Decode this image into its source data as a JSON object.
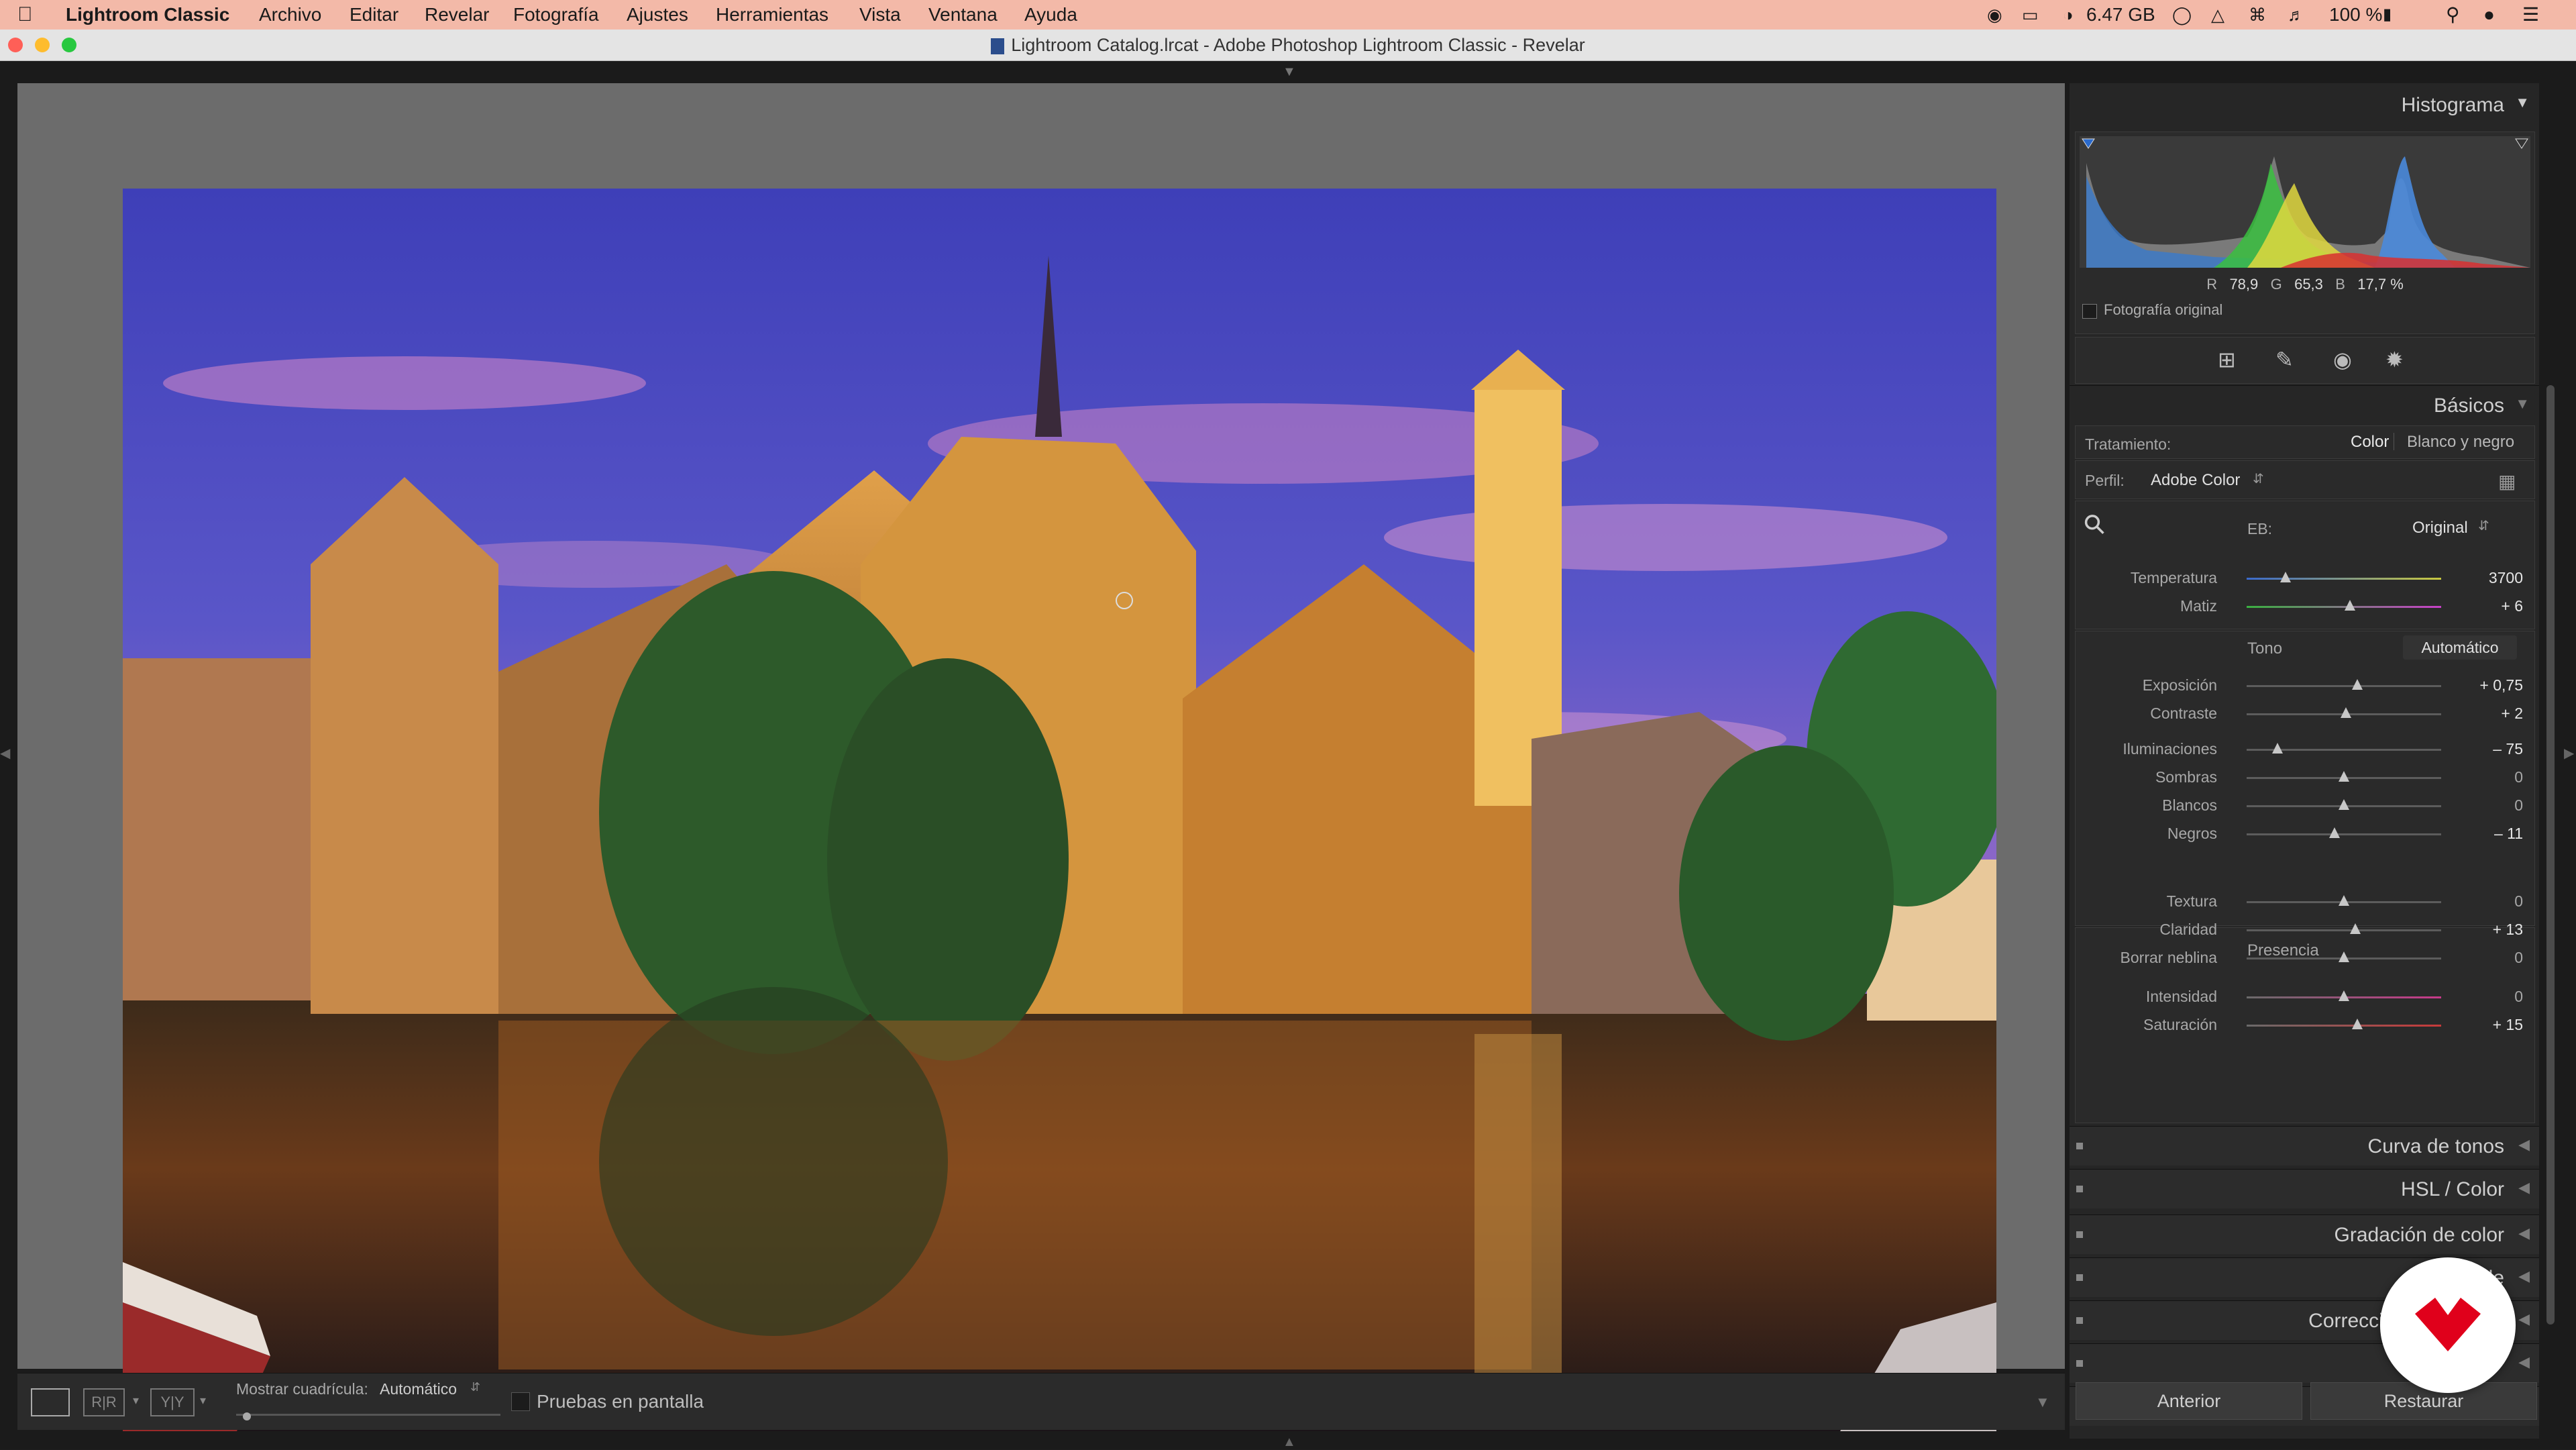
{
  "menubar": {
    "app_name": "Lightroom Classic",
    "items": [
      "Archivo",
      "Editar",
      "Revelar",
      "Fotografía",
      "Ajustes",
      "Herramientas",
      "Vista",
      "Ventana",
      "Ayuda"
    ],
    "status": {
      "memory": "6.47 GB",
      "battery": "100 %"
    }
  },
  "window": {
    "title": "Lightroom Catalog.lrcat - Adobe Photoshop Lightroom Classic - Revelar"
  },
  "histogram": {
    "title": "Histograma",
    "r_label": "R",
    "r_value": "78,9",
    "g_label": "G",
    "g_value": "65,3",
    "b_label": "B",
    "b_value": "17,7 %",
    "original_label": "Fotografía original"
  },
  "basics": {
    "title": "Básicos",
    "treatment_label": "Tratamiento:",
    "treatment_color": "Color",
    "treatment_bw": "Blanco y negro",
    "profile_label": "Perfil:",
    "profile_value": "Adobe Color",
    "wb_label": "EB:",
    "wb_value": "Original",
    "tone_label": "Tono",
    "auto_label": "Automático",
    "presence_label": "Presencia",
    "sliders": [
      {
        "name": "Temperatura",
        "value": "3700",
        "pos": 0.2
      },
      {
        "name": "Matiz",
        "value": "+ 6",
        "pos": 0.53
      },
      {
        "name": "Exposición",
        "value": "+ 0,75",
        "pos": 0.57
      },
      {
        "name": "Contraste",
        "value": "+ 2",
        "pos": 0.51
      },
      {
        "name": "Iluminaciones",
        "value": "– 75",
        "pos": 0.16
      },
      {
        "name": "Sombras",
        "value": "0",
        "pos": 0.5
      },
      {
        "name": "Blancos",
        "value": "0",
        "pos": 0.5
      },
      {
        "name": "Negros",
        "value": "– 11",
        "pos": 0.45
      },
      {
        "name": "Textura",
        "value": "0",
        "pos": 0.5
      },
      {
        "name": "Claridad",
        "value": "+ 13",
        "pos": 0.56
      },
      {
        "name": "Borrar neblina",
        "value": "0",
        "pos": 0.5
      },
      {
        "name": "Intensidad",
        "value": "0",
        "pos": 0.5
      },
      {
        "name": "Saturación",
        "value": "+ 15",
        "pos": 0.57
      }
    ]
  },
  "sections": [
    {
      "label": "Curva de tonos"
    },
    {
      "label": "HSL / Color"
    },
    {
      "label": "Gradación de color"
    },
    {
      "label": "Detalle"
    },
    {
      "label": "Correcciones de lente"
    }
  ],
  "toolbar": {
    "grid_label": "Mostrar cuadrícula:",
    "grid_value": "Automático",
    "proof_label": "Pruebas en pantalla"
  },
  "buttons": {
    "previous": "Anterior",
    "reset": "Restaurar"
  },
  "colors": {
    "menubar_bg": "#f3b9a8",
    "panel_bg": "#262626",
    "brand_badge": "#e0001b"
  }
}
